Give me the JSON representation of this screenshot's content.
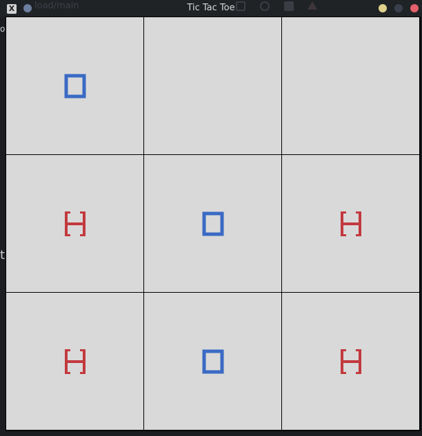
{
  "window": {
    "title": "Tic Tac Toe",
    "app_icon_glyph": "X",
    "background_url_text": "load/main"
  },
  "left_strip": {
    "top_text": "o",
    "mid_text": "ti"
  },
  "colors": {
    "cell_bg": "#d9d9d9",
    "grid_line": "#000000",
    "o_mark": "#3a6ac4",
    "h_mark": "#c2393e"
  },
  "board": {
    "cells": [
      {
        "index": 0,
        "mark": "O"
      },
      {
        "index": 1,
        "mark": ""
      },
      {
        "index": 2,
        "mark": ""
      },
      {
        "index": 3,
        "mark": "H"
      },
      {
        "index": 4,
        "mark": "O"
      },
      {
        "index": 5,
        "mark": "H"
      },
      {
        "index": 6,
        "mark": "H"
      },
      {
        "index": 7,
        "mark": "O"
      },
      {
        "index": 8,
        "mark": "H"
      }
    ]
  },
  "icons": {
    "o_mark_icon": "hollow-rectangle",
    "h_mark_icon": "h-shape"
  }
}
